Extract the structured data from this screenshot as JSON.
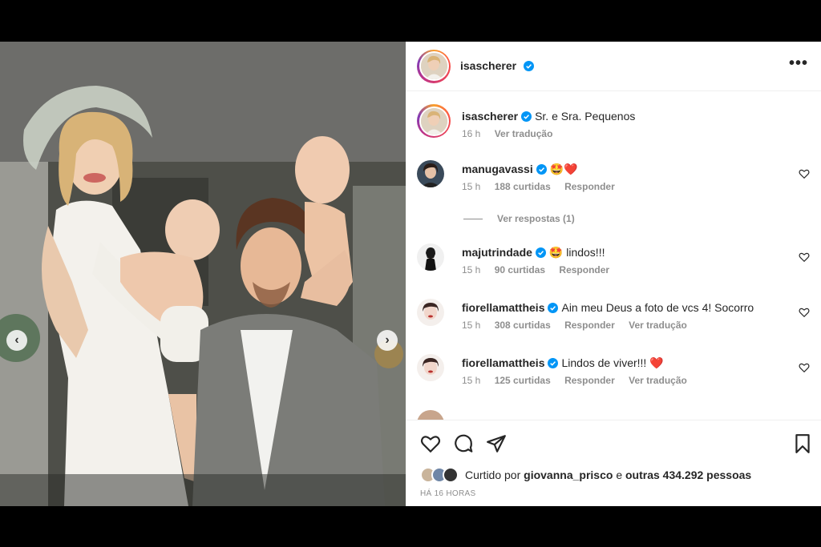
{
  "post": {
    "author": "isascherer",
    "more_glyph": "•••",
    "caption": {
      "username": "isascherer",
      "text": "Sr. e Sra. Pequenos",
      "time": "16 h",
      "translate": "Ver tradução"
    }
  },
  "comments": [
    {
      "username": "manugavassi",
      "text": "🤩❤️",
      "time": "15 h",
      "likes": "188 curtidas",
      "reply": "Responder",
      "translate": ""
    },
    {
      "username": "majutrindade",
      "text": "🤩 lindos!!!",
      "time": "15 h",
      "likes": "90 curtidas",
      "reply": "Responder",
      "translate": ""
    },
    {
      "username": "fiorellamattheis",
      "text": "Ain meu Deus a foto de vcs 4! Socorro",
      "time": "15 h",
      "likes": "308 curtidas",
      "reply": "Responder",
      "translate": "Ver tradução"
    },
    {
      "username": "fiorellamattheis",
      "text": "Lindos de viver!!! ❤️",
      "time": "15 h",
      "likes": "125 curtidas",
      "reply": "Responder",
      "translate": "Ver tradução"
    }
  ],
  "view_replies": "Ver respostas (1)",
  "footer": {
    "liked_prefix": "Curtido por",
    "liked_user": "giovanna_prisco",
    "liked_mid": "e",
    "liked_others": "outras 434.292 pessoas",
    "time_ago": "HÁ 16 HORAS"
  },
  "nav": {
    "prev": "‹",
    "next": "›"
  },
  "icons": [
    "heart-icon",
    "comment-icon",
    "share-icon",
    "bookmark-icon",
    "more-icon",
    "verified-icon",
    "chevron-left-icon",
    "chevron-right-icon"
  ],
  "colors": {
    "verified": "#0095f6",
    "text": "#262626",
    "muted": "#8e8e8e",
    "heart": "#ed4956"
  }
}
